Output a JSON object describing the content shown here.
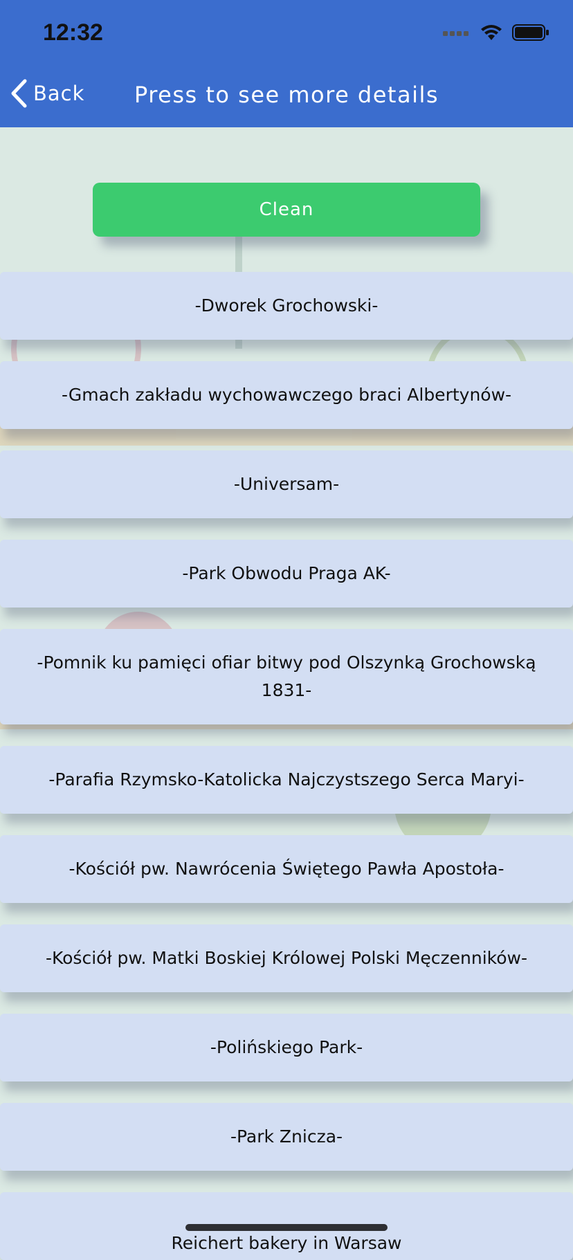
{
  "status_bar": {
    "time": "12:32",
    "icons": [
      "signal-dots-icon",
      "wifi-icon",
      "battery-icon"
    ]
  },
  "nav": {
    "back_label": "Back",
    "title": "Press to see more details"
  },
  "clean_button": {
    "label": "Clean"
  },
  "list": {
    "items": [
      "-Dworek Grochowski-",
      "-Gmach zakładu wychowawczego braci Albertynów-",
      "-Universam-",
      "-Park Obwodu Praga AK-",
      "-Pomnik ku pamięci ofiar bitwy pod Olszynką Grochowską 1831-",
      "-Parafia Rzymsko-Katolicka Najczystszego Serca Maryi-",
      "-Kościół pw. Nawrócenia Świętego Pawła Apostoła-",
      "-Kościół pw. Matki Boskiej Królowej Polski Męczenników-",
      "-Polińskiego Park-",
      "-Park Znicza-",
      "Reichert bakery in Warsaw"
    ]
  },
  "colors": {
    "header": "#3b6dce",
    "clean_button": "#3ccb6f",
    "list_item": "#d3def3",
    "background": "#dbe9e3"
  }
}
